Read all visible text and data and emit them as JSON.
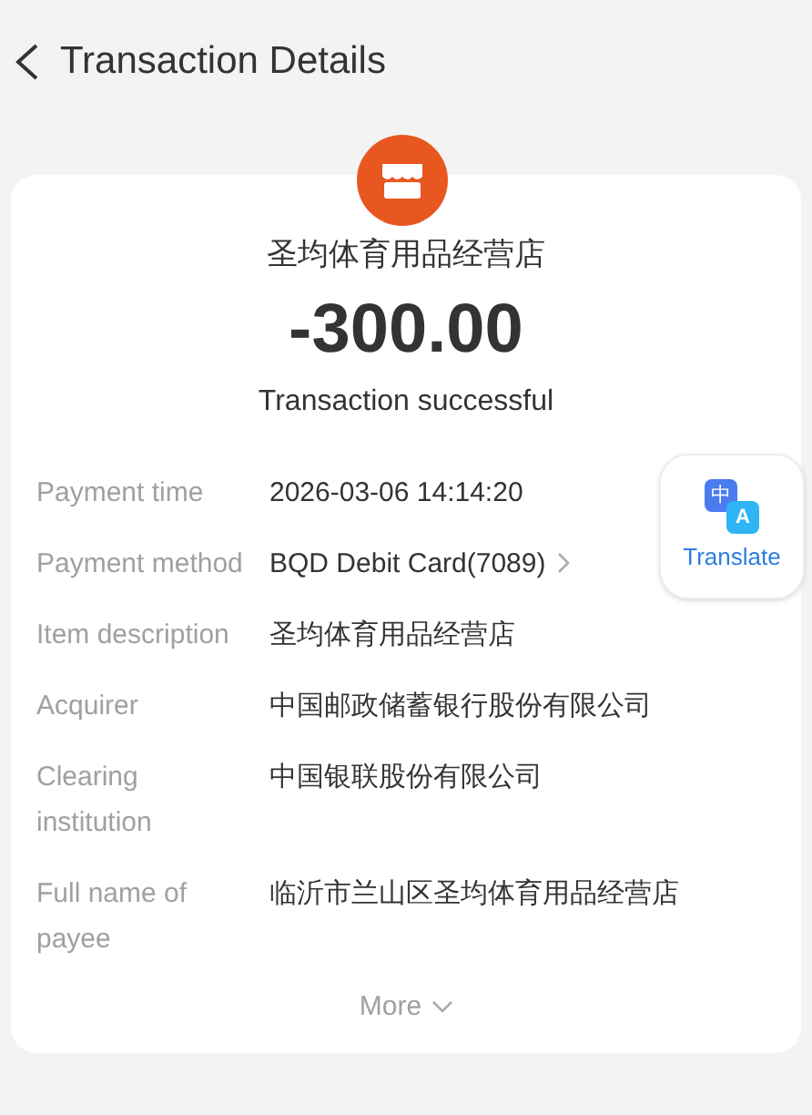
{
  "header": {
    "title": "Transaction Details"
  },
  "merchant": {
    "name": "圣均体育用品经营店",
    "amount": "-300.00",
    "status": "Transaction successful"
  },
  "translate": {
    "label": "Translate",
    "icon_glyphs": [
      "中",
      "A"
    ]
  },
  "details": [
    {
      "label": "Payment time",
      "value": "2026-03-06 14:14:20",
      "kind": "plain"
    },
    {
      "label": "Payment method",
      "value": "BQD Debit Card(7089)",
      "kind": "link"
    },
    {
      "label": "Item description",
      "value": "圣均体育用品经营店",
      "kind": "plain"
    },
    {
      "label": "Acquirer",
      "value": "中国邮政储蓄银行股份有限公司",
      "kind": "plain"
    },
    {
      "label": "Clearing institution",
      "value": "中国银联股份有限公司",
      "kind": "plain"
    },
    {
      "label": "Full name of payee",
      "value": "临沂市兰山区圣均体育用品经营店",
      "kind": "plain"
    }
  ],
  "more": {
    "label": "More"
  }
}
